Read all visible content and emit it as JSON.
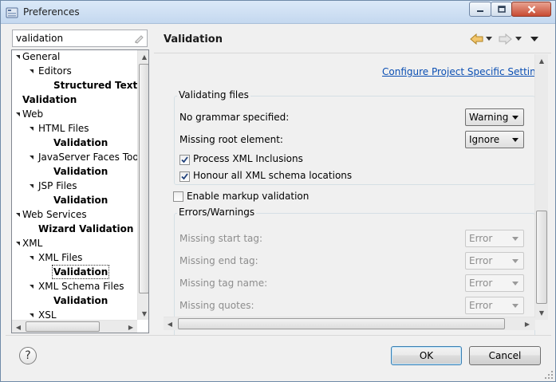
{
  "window": {
    "title": "Preferences"
  },
  "search": {
    "value": "validation"
  },
  "tree": {
    "items": [
      {
        "label": "General",
        "bold": false,
        "expanded": true
      },
      {
        "label": "Editors",
        "bold": false,
        "expanded": true
      },
      {
        "label": "Structured Text",
        "bold": true,
        "expanded": null
      },
      {
        "label": "Validation",
        "bold": true,
        "expanded": null
      },
      {
        "label": "Web",
        "bold": false,
        "expanded": true
      },
      {
        "label": "HTML Files",
        "bold": false,
        "expanded": true
      },
      {
        "label": "Validation",
        "bold": true,
        "expanded": null
      },
      {
        "label": "JavaServer Faces Tools",
        "bold": false,
        "expanded": true
      },
      {
        "label": "Validation",
        "bold": true,
        "expanded": null
      },
      {
        "label": "JSP Files",
        "bold": false,
        "expanded": true
      },
      {
        "label": "Validation",
        "bold": true,
        "expanded": null
      },
      {
        "label": "Web Services",
        "bold": false,
        "expanded": true
      },
      {
        "label": "Wizard Validation",
        "bold": true,
        "expanded": null
      },
      {
        "label": "XML",
        "bold": false,
        "expanded": true
      },
      {
        "label": "XML Files",
        "bold": false,
        "expanded": true
      },
      {
        "label": "Validation",
        "bold": true,
        "expanded": null,
        "selected": true
      },
      {
        "label": "XML Schema Files",
        "bold": false,
        "expanded": true
      },
      {
        "label": "Validation",
        "bold": true,
        "expanded": null
      },
      {
        "label": "XSL",
        "bold": false,
        "expanded": true
      }
    ]
  },
  "page": {
    "title": "Validation",
    "configure_link": "Configure Project Specific Settings..."
  },
  "validating_files": {
    "group_label": "Validating files",
    "no_grammar_label": "No grammar specified:",
    "no_grammar_value": "Warning",
    "missing_root_label": "Missing root element:",
    "missing_root_value": "Ignore",
    "process_xml_label": "Process XML Inclusions",
    "process_xml_checked": true,
    "honour_schema_label": "Honour all XML schema locations",
    "honour_schema_checked": true
  },
  "markup": {
    "enable_label": "Enable markup validation",
    "enable_checked": false
  },
  "errors_warnings": {
    "group_label": "Errors/Warnings",
    "rows": [
      {
        "label": "Missing start tag:",
        "value": "Error"
      },
      {
        "label": "Missing end tag:",
        "value": "Error"
      },
      {
        "label": "Missing tag name:",
        "value": "Error"
      },
      {
        "label": "Missing quotes:",
        "value": "Error"
      }
    ]
  },
  "buttons": {
    "help": "?",
    "ok": "OK",
    "cancel": "Cancel"
  }
}
